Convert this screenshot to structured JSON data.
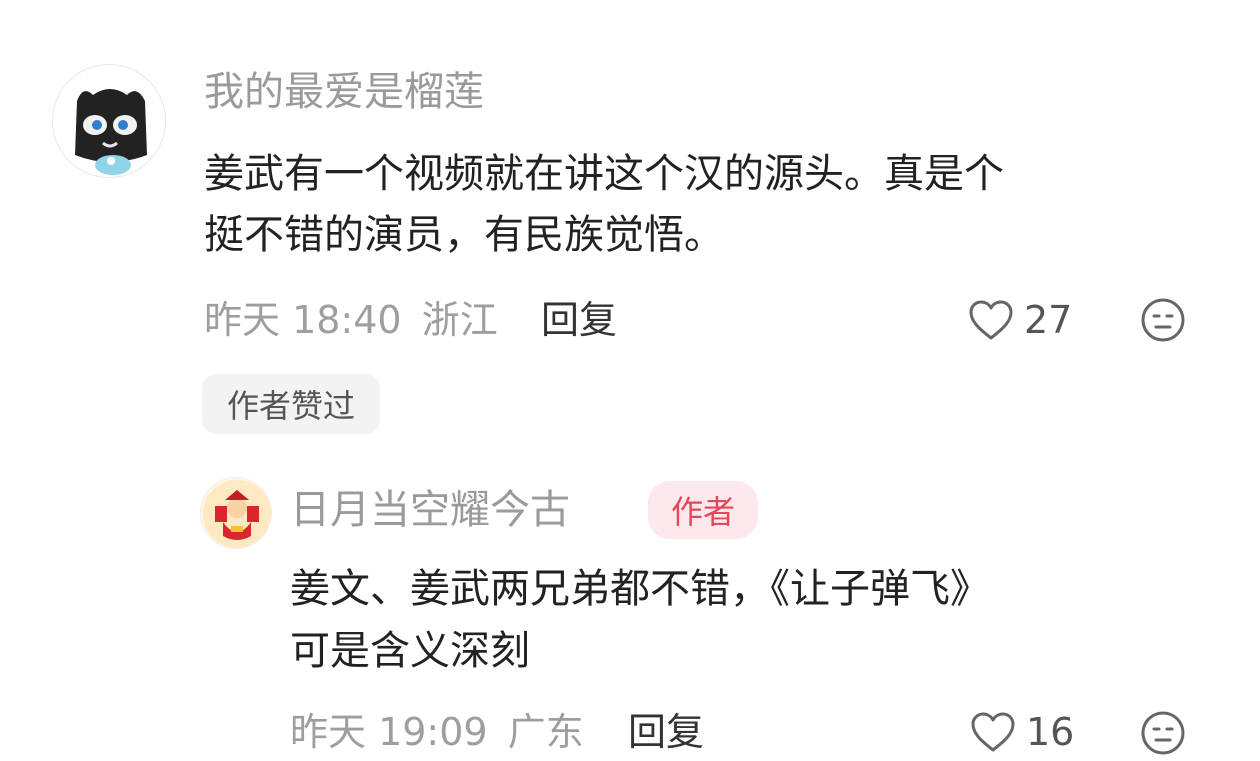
{
  "comment": {
    "username": "我的最爱是榴莲",
    "avatar_icon": "masked-character-avatar-icon",
    "text_line1": "姜武有一个视频就在讲这个汉的源头。真是个",
    "text_line2": "挺不错的演员，有民族觉悟。",
    "time": "昨天 18:40",
    "location": "浙江",
    "reply_label": "回复",
    "like_count": "27",
    "author_liked_chip": "作者赞过"
  },
  "reply": {
    "username": "日月当空耀今古",
    "avatar_icon": "god-of-wealth-avatar-icon",
    "author_badge": "作者",
    "text_line1": "姜文、姜武两兄弟都不错，《让子弹飞》",
    "text_line2": "可是含义深刻",
    "time": "昨天 19:09",
    "location": "广东",
    "reply_label": "回复",
    "like_count": "16"
  },
  "colors": {
    "username": "#9a9a9a",
    "content": "#222222",
    "meta": "#9e9e9e",
    "badge_bg": "#fde8ec",
    "badge_text": "#e2485b"
  }
}
